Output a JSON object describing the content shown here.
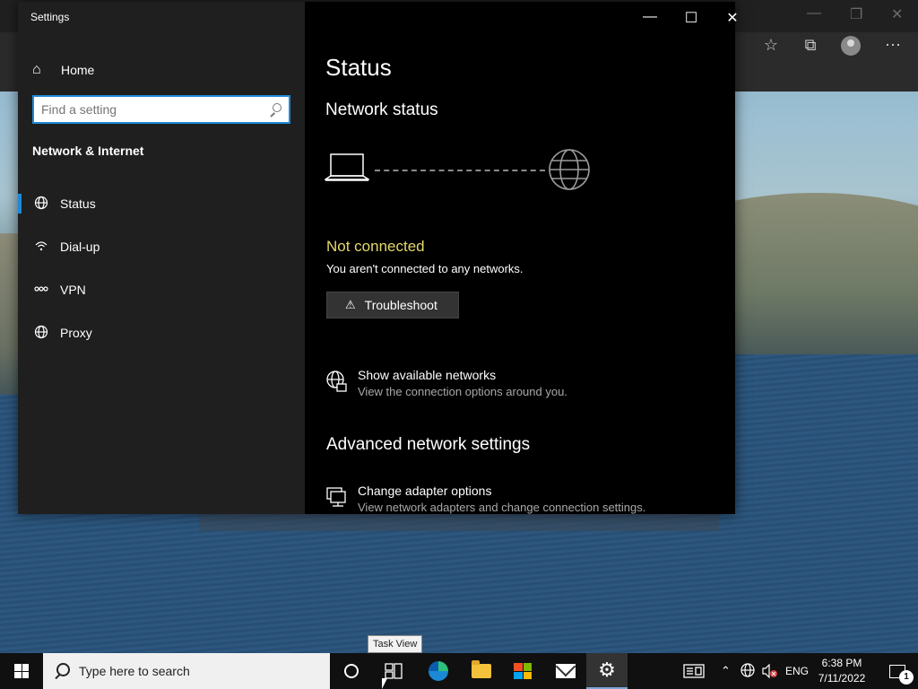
{
  "settings": {
    "app_title": "Settings",
    "sidebar": {
      "home_label": "Home",
      "search_placeholder": "Find a setting",
      "section_title": "Network & Internet",
      "items": [
        {
          "label": "Status",
          "icon": "globe-icon",
          "active": true
        },
        {
          "label": "Dial-up",
          "icon": "dialup-icon",
          "active": false
        },
        {
          "label": "VPN",
          "icon": "vpn-icon",
          "active": false
        },
        {
          "label": "Proxy",
          "icon": "globe-icon",
          "active": false
        }
      ]
    },
    "content": {
      "page_title": "Status",
      "network_status_heading": "Network status",
      "connection_state": "Not connected",
      "connection_description": "You aren't connected to any networks.",
      "troubleshoot_label": "Troubleshoot",
      "show_networks": {
        "title": "Show available networks",
        "subtitle": "View the connection options around you."
      },
      "advanced_heading": "Advanced network settings",
      "change_adapter": {
        "title": "Change adapter options",
        "subtitle": "View network adapters and change connection settings."
      }
    },
    "colors": {
      "accent": "#1f8ad6",
      "warning_text": "#e5d86a",
      "sidebar_bg": "#1f1f1f",
      "content_bg": "#000000"
    }
  },
  "taskbar": {
    "search_placeholder": "Type here to search",
    "tooltip": "Task View",
    "language": "ENG",
    "time": "6:38 PM",
    "date": "7/11/2022",
    "notification_count": "1"
  }
}
